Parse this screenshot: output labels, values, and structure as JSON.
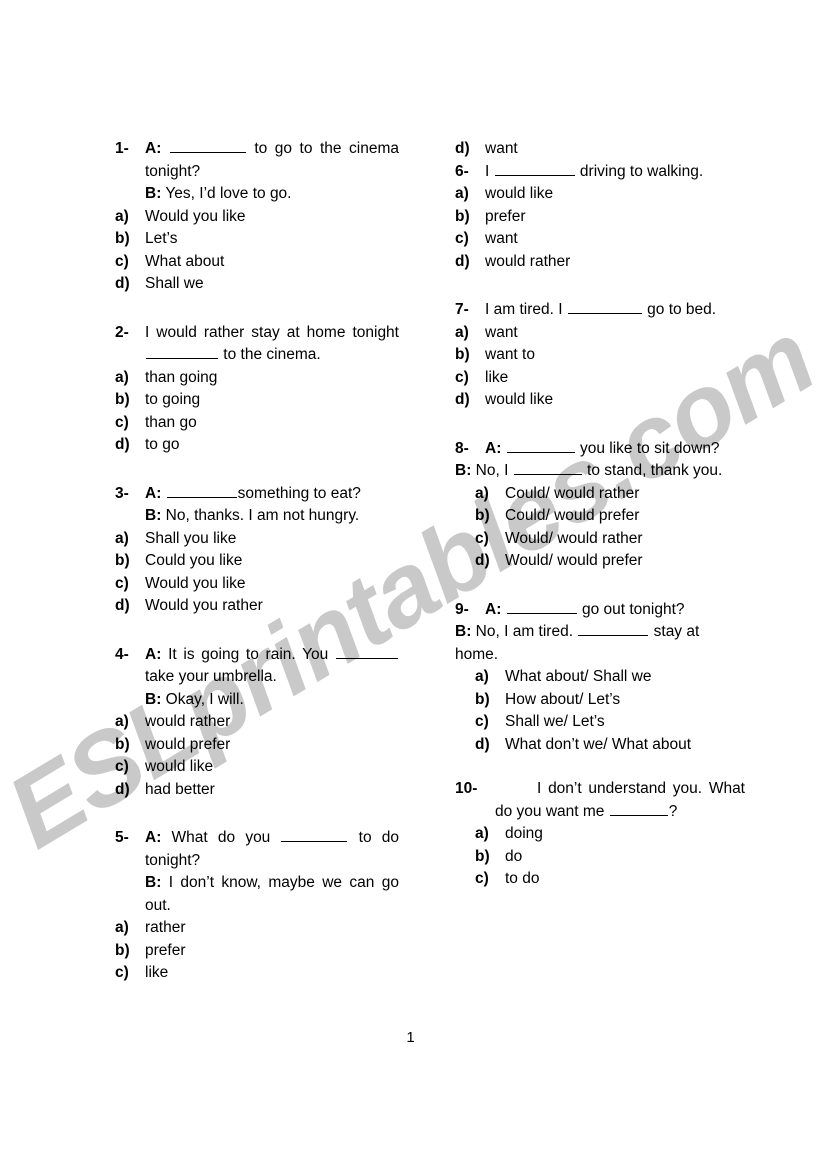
{
  "document": {
    "type": "esl-multiple-choice-worksheet",
    "page_number": "1",
    "watermark": "ESLprintables.com",
    "watermark_color": "#c9c9c9",
    "text_color": "#000000",
    "background_color": "#ffffff"
  },
  "labels": {
    "speaker_a": "A:",
    "speaker_b": "B:",
    "opt_a": "a)",
    "opt_b": "b)",
    "opt_c": "c)",
    "opt_d": "d)"
  },
  "questions": [
    {
      "number": "1-",
      "prompt_a_pre": "",
      "prompt_a_post": " to go to the cinema tonight?",
      "prompt_b": "Yes, I’d love to go.",
      "options": [
        "Would you like",
        "Let’s",
        "What about",
        "Shall we"
      ]
    },
    {
      "number": "2-",
      "stem_pre": "I would rather stay at home tonight ",
      "stem_post": " to the cinema.",
      "options": [
        "than going",
        "to going",
        "than go",
        "to go"
      ]
    },
    {
      "number": "3-",
      "prompt_a_pre": "",
      "prompt_a_post": "something to eat?",
      "prompt_b": "No, thanks. I am not hungry.",
      "options": [
        "Shall you like",
        "Could you like",
        "Would you like",
        "Would you rather"
      ]
    },
    {
      "number": "4-",
      "prompt_a_pre": "It is going to rain. You ",
      "prompt_a_post": "take your umbrella.",
      "prompt_b": "Okay, I will.",
      "options": [
        "would rather",
        "would prefer",
        "would like",
        "had better"
      ]
    },
    {
      "number": "5-",
      "prompt_a_pre": "What do you ",
      "prompt_a_post": " to do tonight?",
      "prompt_b": "I don’t know, maybe we can go out.",
      "options": [
        "rather",
        "prefer",
        "like",
        "want"
      ]
    },
    {
      "number": "6-",
      "stem_pre": "I ",
      "stem_post": " driving to walking.",
      "options": [
        "would like",
        "prefer",
        "want",
        "would rather"
      ]
    },
    {
      "number": "7-",
      "stem_pre": "I am tired. I ",
      "stem_post": " go to bed.",
      "options": [
        "want",
        "want to",
        "like",
        "would like"
      ]
    },
    {
      "number": "8-",
      "prompt_a_pre": "",
      "prompt_a_post": " you like to sit down?",
      "prompt_b_pre": "No, I ",
      "prompt_b_post": " to stand, thank you.",
      "options": [
        "Could/ would rather",
        "Could/ would prefer",
        "Would/ would rather",
        "Would/ would prefer"
      ]
    },
    {
      "number": "9-",
      "prompt_a_pre": "",
      "prompt_a_post": " go out tonight?",
      "prompt_b_pre": "No, I am tired. ",
      "prompt_b_post": " stay at home.",
      "options": [
        "What about/ Shall we",
        "How about/ Let’s",
        "Shall we/ Let’s",
        "What don’t we/ What about"
      ]
    },
    {
      "number": "10-",
      "stem_pre": "I don’t understand you. What do you want me ",
      "stem_post": "?",
      "options": [
        "doing",
        "do",
        "to do"
      ]
    }
  ]
}
